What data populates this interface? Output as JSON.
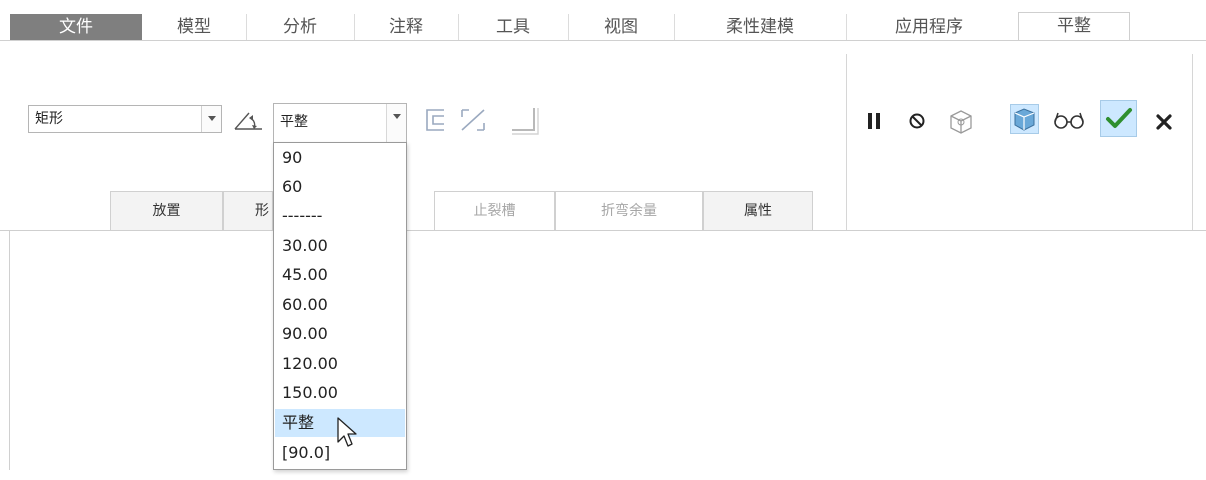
{
  "tabs": [
    {
      "id": "file",
      "label": "文件"
    },
    {
      "id": "model",
      "label": "模型"
    },
    {
      "id": "analysis",
      "label": "分析"
    },
    {
      "id": "annotate",
      "label": "注释"
    },
    {
      "id": "tools",
      "label": "工具"
    },
    {
      "id": "view",
      "label": "视图"
    },
    {
      "id": "flexible",
      "label": "柔性建模"
    },
    {
      "id": "apps",
      "label": "应用程序"
    },
    {
      "id": "flat",
      "label": "平整"
    }
  ],
  "shape_select": {
    "value": "矩形"
  },
  "angle_select": {
    "value": "平整"
  },
  "sub_tabs": [
    {
      "label": "放置"
    },
    {
      "label": "形"
    },
    {
      "label": "止裂槽"
    },
    {
      "label": "折弯余量"
    },
    {
      "label": "属性"
    }
  ],
  "dropdown": {
    "options": [
      "90",
      "60",
      "-------",
      "30.00",
      "45.00",
      "60.00",
      "90.00",
      "120.00",
      "150.00",
      "平整",
      "[90.0]"
    ],
    "selected": "平整"
  },
  "colors": {
    "file_tab_bg": "#7f7f7f",
    "highlight": "#cde8ff",
    "ok_check": "#2f8f2f"
  },
  "icons": [
    "angle-icon",
    "side-icon",
    "flip-icon",
    "shape-corner-icon",
    "pause-icon",
    "stop-icon",
    "preview-icon",
    "show-geometry-icon",
    "glasses-icon",
    "ok-check-icon",
    "cancel-x-icon",
    "mouse-cursor-icon"
  ]
}
